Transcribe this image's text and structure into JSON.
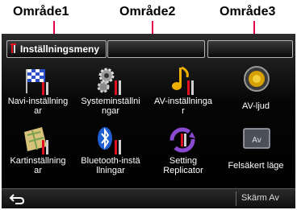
{
  "annotations": {
    "area1": "Område1",
    "area2": "Område2",
    "area3": "Område3"
  },
  "colors": {
    "leader": "#e4004f",
    "screen_bg": "#000000",
    "box_border": "#b5b5b5"
  },
  "title_bar": {
    "area1_text": "Inställningsmeny",
    "area1_icon": "settings-tools-icon",
    "area2_text": "",
    "area3_text": ""
  },
  "menu": {
    "items": [
      {
        "label1": "Navi-inställning",
        "label2": "ar",
        "icon": "navi-flag-tools-icon"
      },
      {
        "label1": "Systeminställni",
        "label2": "ngar",
        "icon": "gears-tools-icon"
      },
      {
        "label1": "AV-inställninga",
        "label2": "r",
        "icon": "music-note-tools-icon"
      },
      {
        "label1": "AV-ljud",
        "label2": "",
        "icon": "speaker-icon"
      },
      {
        "label1": "Kartinställning",
        "label2": "ar",
        "icon": "map-tools-icon"
      },
      {
        "label1": "Bluetooth-instä",
        "label2": "llningar",
        "icon": "bluetooth-tools-icon"
      },
      {
        "label1": "Setting",
        "label2": "Replicator",
        "icon": "replicator-cycle-icon"
      },
      {
        "label1": "Felsäkert läge",
        "label2": "",
        "icon": "av-monitor-icon"
      }
    ]
  },
  "bottom_bar": {
    "back_icon": "back-arrow-icon",
    "screen_off_label": "Skärm Av"
  }
}
